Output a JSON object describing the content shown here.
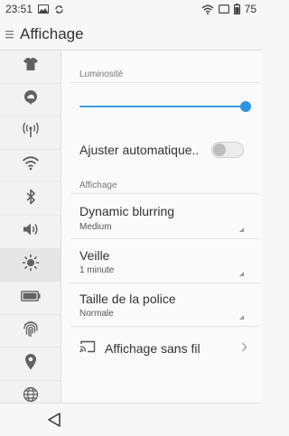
{
  "status_bar": {
    "time": "23:51",
    "battery_level": "75",
    "icons": [
      "image-icon",
      "sync-icon",
      "wifi-icon",
      "screen-icon",
      "battery-icon"
    ]
  },
  "app_bar": {
    "title": "Affichage",
    "menu_icon": "hamburger-icon"
  },
  "sidebar": {
    "active_index": 6,
    "items": [
      {
        "icon": "tshirt-icon"
      },
      {
        "icon": "cloud-pin-icon"
      },
      {
        "icon": "hotspot-icon"
      },
      {
        "icon": "wifi-icon"
      },
      {
        "icon": "bluetooth-icon"
      },
      {
        "icon": "speaker-icon"
      },
      {
        "icon": "brightness-icon"
      },
      {
        "icon": "battery-icon"
      },
      {
        "icon": "fingerprint-icon"
      },
      {
        "icon": "location-icon"
      },
      {
        "icon": "globe-icon"
      }
    ]
  },
  "settings": {
    "brightness_label": "Luminosité",
    "brightness_level": 1.0,
    "auto_adjust": {
      "label": "Ajuster automatique..",
      "enabled": false
    },
    "display_section_label": "Affichage",
    "dynamic_blurring": {
      "title": "Dynamic blurring",
      "value": "Medium"
    },
    "sleep": {
      "title": "Veille",
      "value": "1 minute"
    },
    "font_size": {
      "title": "Taille de la police",
      "value": "Normale"
    },
    "wireless_display": {
      "label": "Affichage sans fil"
    }
  },
  "nav_bar": {
    "back_icon": "back-triangle-icon"
  },
  "colors": {
    "accent": "#2f95e0",
    "background": "#fafafa",
    "sidebar": "#f2f2f2"
  }
}
